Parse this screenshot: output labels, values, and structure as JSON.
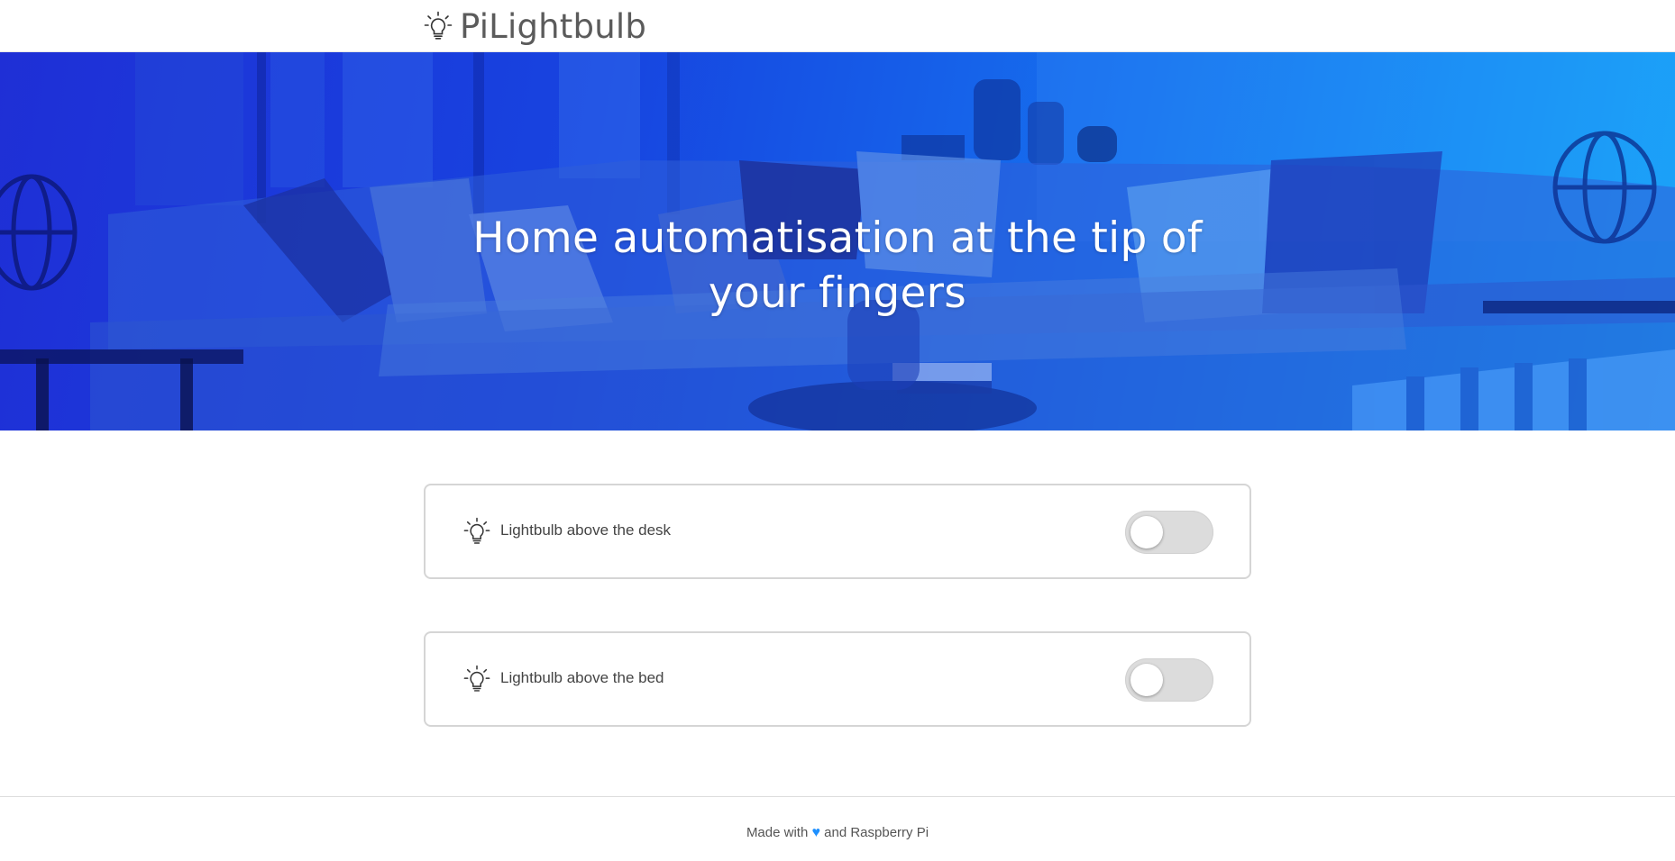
{
  "header": {
    "brand_name": "PiLightbulb",
    "brand_icon": "lightbulb-icon"
  },
  "hero": {
    "title": "Home automatisation at the tip of your fingers",
    "overlay_color": "#1a4fe6"
  },
  "lights": [
    {
      "label": "Lightbulb above the desk",
      "icon": "lightbulb-icon",
      "state": "off"
    },
    {
      "label": "Lightbulb above the bed",
      "icon": "lightbulb-icon",
      "state": "off"
    }
  ],
  "footer": {
    "made_with": "Made with",
    "heart": "♥",
    "suffix": "and Raspberry Pi",
    "heart_color": "#1e90ff"
  },
  "colors": {
    "toggle_off": "#dcdcdc",
    "card_border": "#d5d5d5"
  }
}
